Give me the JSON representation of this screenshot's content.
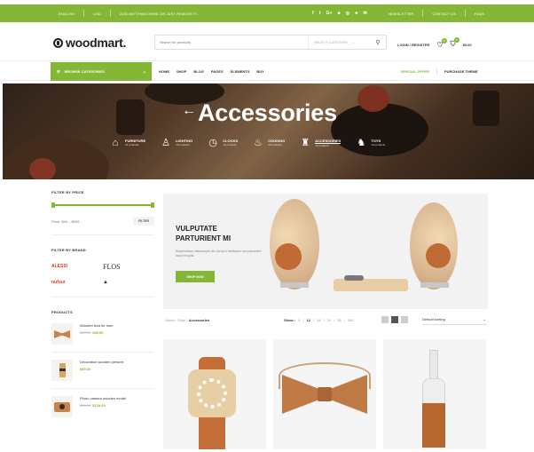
{
  "topbar": {
    "language": "ENGLISH",
    "currency": "USD",
    "promo": "ADD ANYTHING HERE OR JUST REMOVE IT...",
    "social": [
      "f",
      "t",
      "G+",
      "■",
      "◎",
      "♣",
      "✉"
    ],
    "newsletter": "NEWSLETTER",
    "contact": "CONTACT US",
    "faqs": "FAQS"
  },
  "header": {
    "logo": "woodmart.",
    "search_placeholder": "Search for products",
    "search_category": "SELECT CATEGORY",
    "login": "LOGIN / REGISTER",
    "wishlist_count": "0",
    "cart_count": "0",
    "cart_total": "$0.00"
  },
  "nav": {
    "browse": "BROWSE CATEGORIES",
    "items": [
      "HOME",
      "SHOP",
      "BLOG",
      "PAGES",
      "ELEMENTS",
      "BUY"
    ],
    "special": "SPECIAL OFFER",
    "purchase": "PURCHASE THEME"
  },
  "hero": {
    "back": "←",
    "title": "Accessories",
    "categories": [
      {
        "name": "FURNITURE",
        "count": "22 products",
        "icon": "sofa-icon"
      },
      {
        "name": "LIGHTING",
        "count": "15 products",
        "icon": "lamp-icon"
      },
      {
        "name": "CLOCKS",
        "count": "12 products",
        "icon": "clock-icon"
      },
      {
        "name": "COOKING",
        "count": "14 products",
        "icon": "pot-icon"
      },
      {
        "name": "ACCESSORIES",
        "count": "12 products",
        "icon": "bag-icon"
      },
      {
        "name": "TOYS",
        "count": "10 products",
        "icon": "horse-icon"
      }
    ]
  },
  "sidebar": {
    "price_title": "FILTER BY PRICE",
    "price_label": "Price: $49 – $599",
    "filter_button": "FILTER",
    "brand_title": "FILTER BY BRAND",
    "brands": [
      "ALESSI",
      "FLOS",
      "nufour",
      "▲"
    ],
    "products_title": "PRODUCTS",
    "products": [
      {
        "name": "Wooden bow tie mon",
        "old_price": "$49.00",
        "price": "$39.00"
      },
      {
        "name": "Decoration wooden present",
        "old_price": "",
        "price": "$89.00"
      },
      {
        "name": "Photo camera wooden model",
        "old_price": "$56.00",
        "price": "$129.00"
      }
    ]
  },
  "promo": {
    "title_line1": "VULPUTATE",
    "title_line2": "PARTURIENT MI",
    "text": "Suspendisse ullamcorper dis dol ipso habitasse non parturient fusce fringilla.",
    "button": "SHOP NOW"
  },
  "toolbar": {
    "crumb_home": "Home",
    "crumb_shop": "Shop",
    "crumb_current": "Accessories",
    "show_label": "Show :",
    "show_options": [
      "9",
      "12",
      "18",
      "24",
      "36",
      "100"
    ],
    "show_current": "12",
    "sorting": "Default sorting"
  },
  "colors": {
    "accent": "#83b735",
    "wood": "#c8824b"
  }
}
